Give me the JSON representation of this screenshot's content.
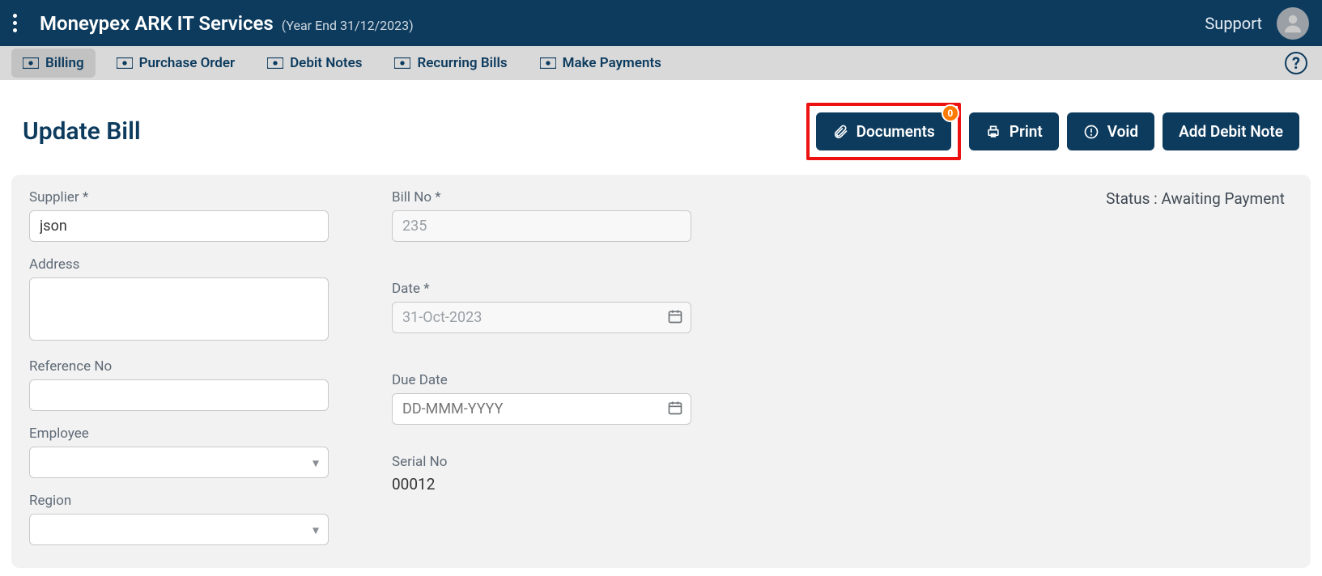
{
  "header": {
    "app_name": "Moneypex ARK IT Services",
    "year_end": "(Year End 31/12/2023)",
    "support_label": "Support"
  },
  "nav": {
    "items": [
      {
        "label": "Billing",
        "active": true
      },
      {
        "label": "Purchase Order",
        "active": false
      },
      {
        "label": "Debit Notes",
        "active": false
      },
      {
        "label": "Recurring Bills",
        "active": false
      },
      {
        "label": "Make Payments",
        "active": false
      }
    ],
    "help_glyph": "?"
  },
  "page": {
    "title": "Update Bill",
    "buttons": {
      "documents": "Documents",
      "documents_badge": "0",
      "print": "Print",
      "void": "Void",
      "add_debit_note": "Add Debit Note"
    },
    "status_label": "Status : ",
    "status_value": "Awaiting Payment"
  },
  "form": {
    "supplier": {
      "label": "Supplier *",
      "value": "json"
    },
    "address": {
      "label": "Address",
      "value": ""
    },
    "reference_no": {
      "label": "Reference No",
      "value": ""
    },
    "employee": {
      "label": "Employee",
      "value": ""
    },
    "region": {
      "label": "Region",
      "value": ""
    },
    "bill_no": {
      "label": "Bill No *",
      "value": "235"
    },
    "date": {
      "label": "Date *",
      "value": "31-Oct-2023"
    },
    "due_date": {
      "label": "Due Date",
      "placeholder": "DD-MMM-YYYY",
      "value": ""
    },
    "serial_no": {
      "label": "Serial No",
      "value": "00012"
    }
  }
}
